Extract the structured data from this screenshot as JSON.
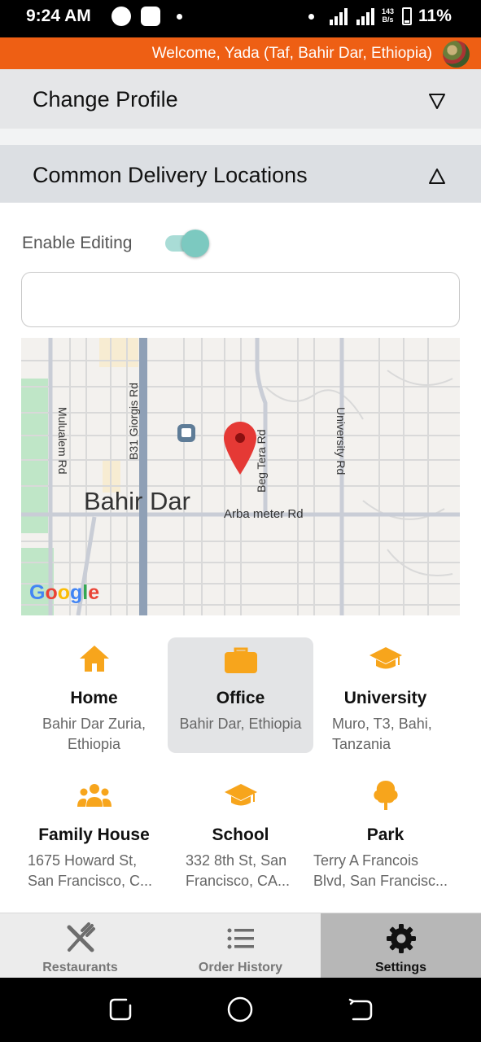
{
  "status_bar": {
    "time": "9:24 AM",
    "speed": "143\nB/s",
    "battery": "11%"
  },
  "welcome": {
    "text": "Welcome, Yada (Taf, Bahir Dar, Ethiopia)",
    "avatar_icon": "user-avatar"
  },
  "change_profile": {
    "title": "Change Profile",
    "arrow_icon": "triangle-down-icon"
  },
  "delivery_locations": {
    "title": "Common Delivery Locations",
    "arrow_icon": "triangle-up-icon",
    "enable_editing_label": "Enable Editing",
    "enable_editing_on": true,
    "search_value": "",
    "search_placeholder": ""
  },
  "map": {
    "city_label": "Bahir Dar",
    "street_labels": {
      "mulualem": "Mulualem Rd",
      "giorgis": "B31 Giorgis Rd",
      "begtera": "Beg Tera Rd",
      "university": "University Rd",
      "arba_meter": "Arba meter Rd"
    },
    "logo": "Google"
  },
  "locations": [
    {
      "name": "Home",
      "address": [
        "Bahir Dar Zuria,",
        "Ethiopia"
      ],
      "icon": "home-icon",
      "selected": false
    },
    {
      "name": "Office",
      "address": [
        "Bahir Dar, Ethiopia"
      ],
      "icon": "briefcase-icon",
      "selected": true
    },
    {
      "name": "University",
      "address": [
        "Muro, T3, Bahi,",
        "Tanzania"
      ],
      "icon": "graduation-cap-icon",
      "selected": false
    },
    {
      "name": "Family House",
      "address": [
        "1675 Howard St,",
        "San Francisco, C..."
      ],
      "icon": "people-icon",
      "selected": false
    },
    {
      "name": "School",
      "address": [
        "332 8th St, San",
        "Francisco, CA..."
      ],
      "icon": "graduation-cap-icon",
      "selected": false
    },
    {
      "name": "Park",
      "address": [
        "Terry A Francois",
        "Blvd, San Francisc..."
      ],
      "icon": "tree-icon",
      "selected": false
    }
  ],
  "bottom_nav": [
    {
      "label": "Restaurants",
      "icon": "fork-knife-icon",
      "active": false
    },
    {
      "label": "Order History",
      "icon": "list-icon",
      "active": false
    },
    {
      "label": "Settings",
      "icon": "gear-icon",
      "active": true
    }
  ],
  "colors": {
    "accent": "#ee5f14",
    "icon_orange": "#f7a51c",
    "toggle_teal": "#7cc9c0",
    "pin_red": "#e53935"
  }
}
